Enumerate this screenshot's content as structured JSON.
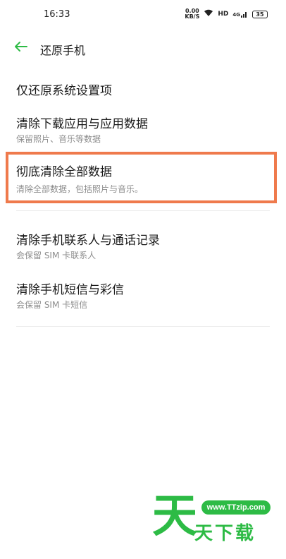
{
  "status_bar": {
    "time": "16:33",
    "net_speed_value": "0.00",
    "net_speed_unit": "KB/S",
    "network_type": "HD",
    "signal_label": "4G",
    "battery": "35"
  },
  "header": {
    "back_icon": "back-arrow-icon",
    "title": "还原手机",
    "accent_color": "#2dbb45"
  },
  "options": [
    {
      "title": "仅还原系统设置项"
    },
    {
      "title": "清除下载应用与应用数据",
      "subtitle": "保留照片、音乐等数据"
    },
    {
      "title": "彻底清除全部数据",
      "subtitle": "清除全部数据，包括照片与音乐。",
      "highlighted": true,
      "highlight_color": "#ef7a4c"
    },
    {
      "title": "清除手机联系人与通话记录",
      "subtitle": "会保留 SIM 卡联系人"
    },
    {
      "title": "清除手机短信与彩信",
      "subtitle": "会保留 SIM 卡短信"
    }
  ],
  "watermark": {
    "big_char": "天",
    "url": "www.TTzip.com",
    "text": "天下载",
    "color": "#2dbb45"
  }
}
